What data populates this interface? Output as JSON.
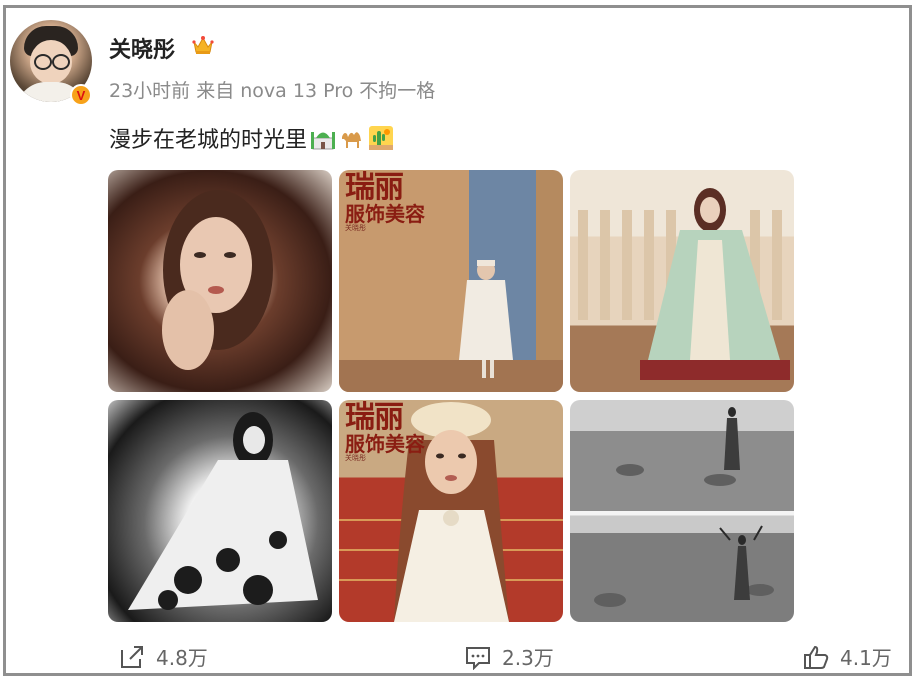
{
  "post": {
    "username": "关晓彤",
    "meta": "23小时前  来自 nova 13 Pro 不拘一格",
    "text": "漫步在老城的时光里",
    "emojis": [
      "mosque-icon",
      "camel-icon",
      "desert-cactus-icon"
    ]
  },
  "magazine": {
    "title_big": "瑞丽",
    "title_sub": "服饰美容",
    "cover_name": "关晓彤"
  },
  "actions": {
    "share": "4.8万",
    "comment": "2.3万",
    "like": "4.1万"
  },
  "colors": {
    "border": "#8f8f8f",
    "meta_text": "#8a8a8a",
    "magazine_red": "#8a1d12",
    "badge_orange": "#f7a21a"
  }
}
